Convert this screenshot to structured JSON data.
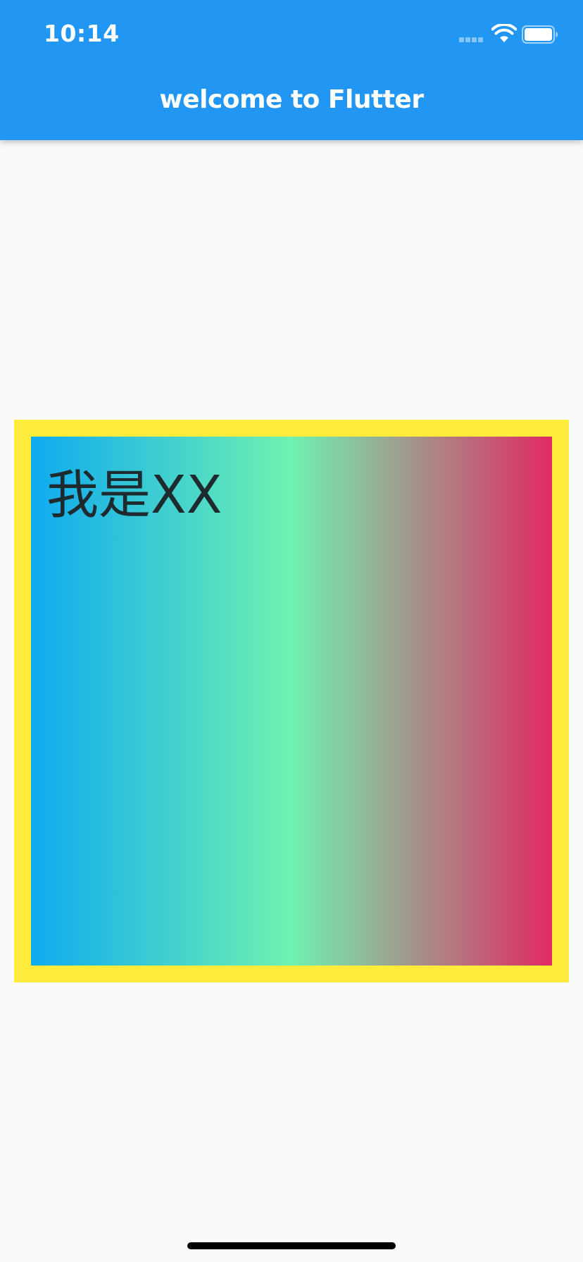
{
  "status_bar": {
    "time": "10:14"
  },
  "app_bar": {
    "title": "welcome to Flutter",
    "color": "#2196f3"
  },
  "card": {
    "text": "我是XX",
    "border_color": "#ffeb3b",
    "gradient_colors": [
      "#0faaf0",
      "#6ff2b0",
      "#e02a62"
    ]
  },
  "icons": {
    "signal": "cellular-signal-icon",
    "wifi": "wifi-icon",
    "battery": "battery-icon"
  }
}
